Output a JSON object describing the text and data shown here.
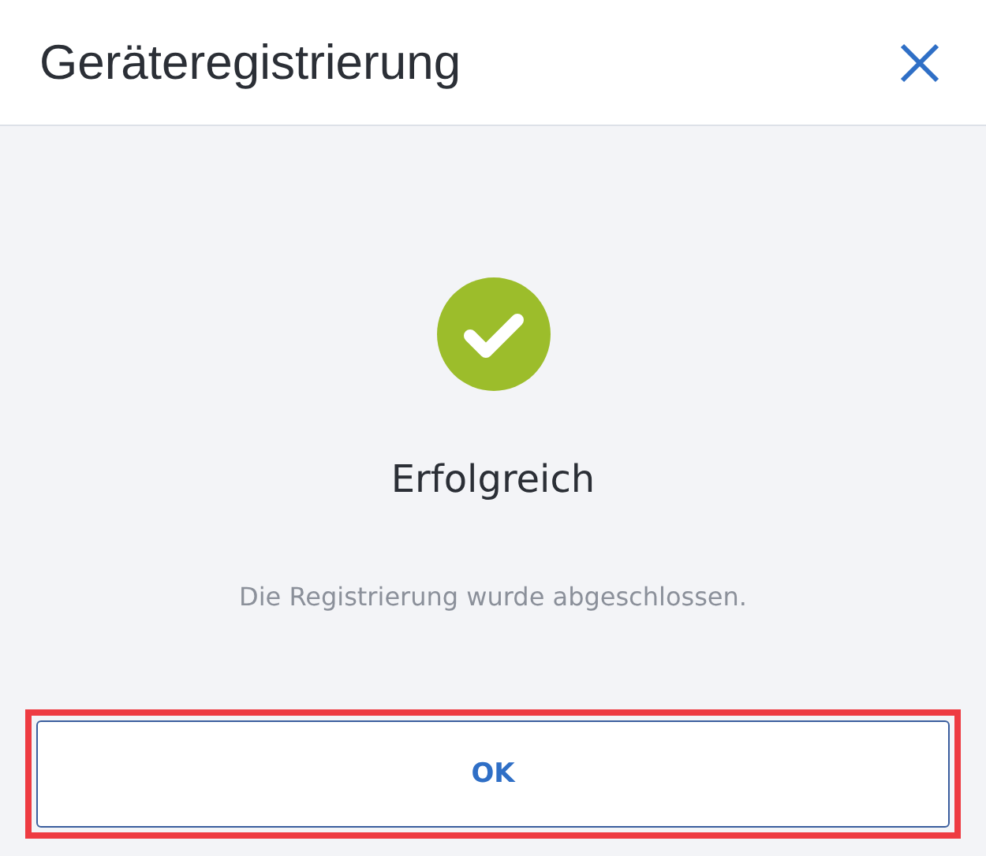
{
  "dialog": {
    "title": "Geräteregistrierung"
  },
  "result": {
    "succeeded": true,
    "heading": "Erfolgreich",
    "message": "Die Registrierung wurde abgeschlossen."
  },
  "buttons": [
    {
      "label": "OK",
      "highlighted": true
    }
  ]
}
